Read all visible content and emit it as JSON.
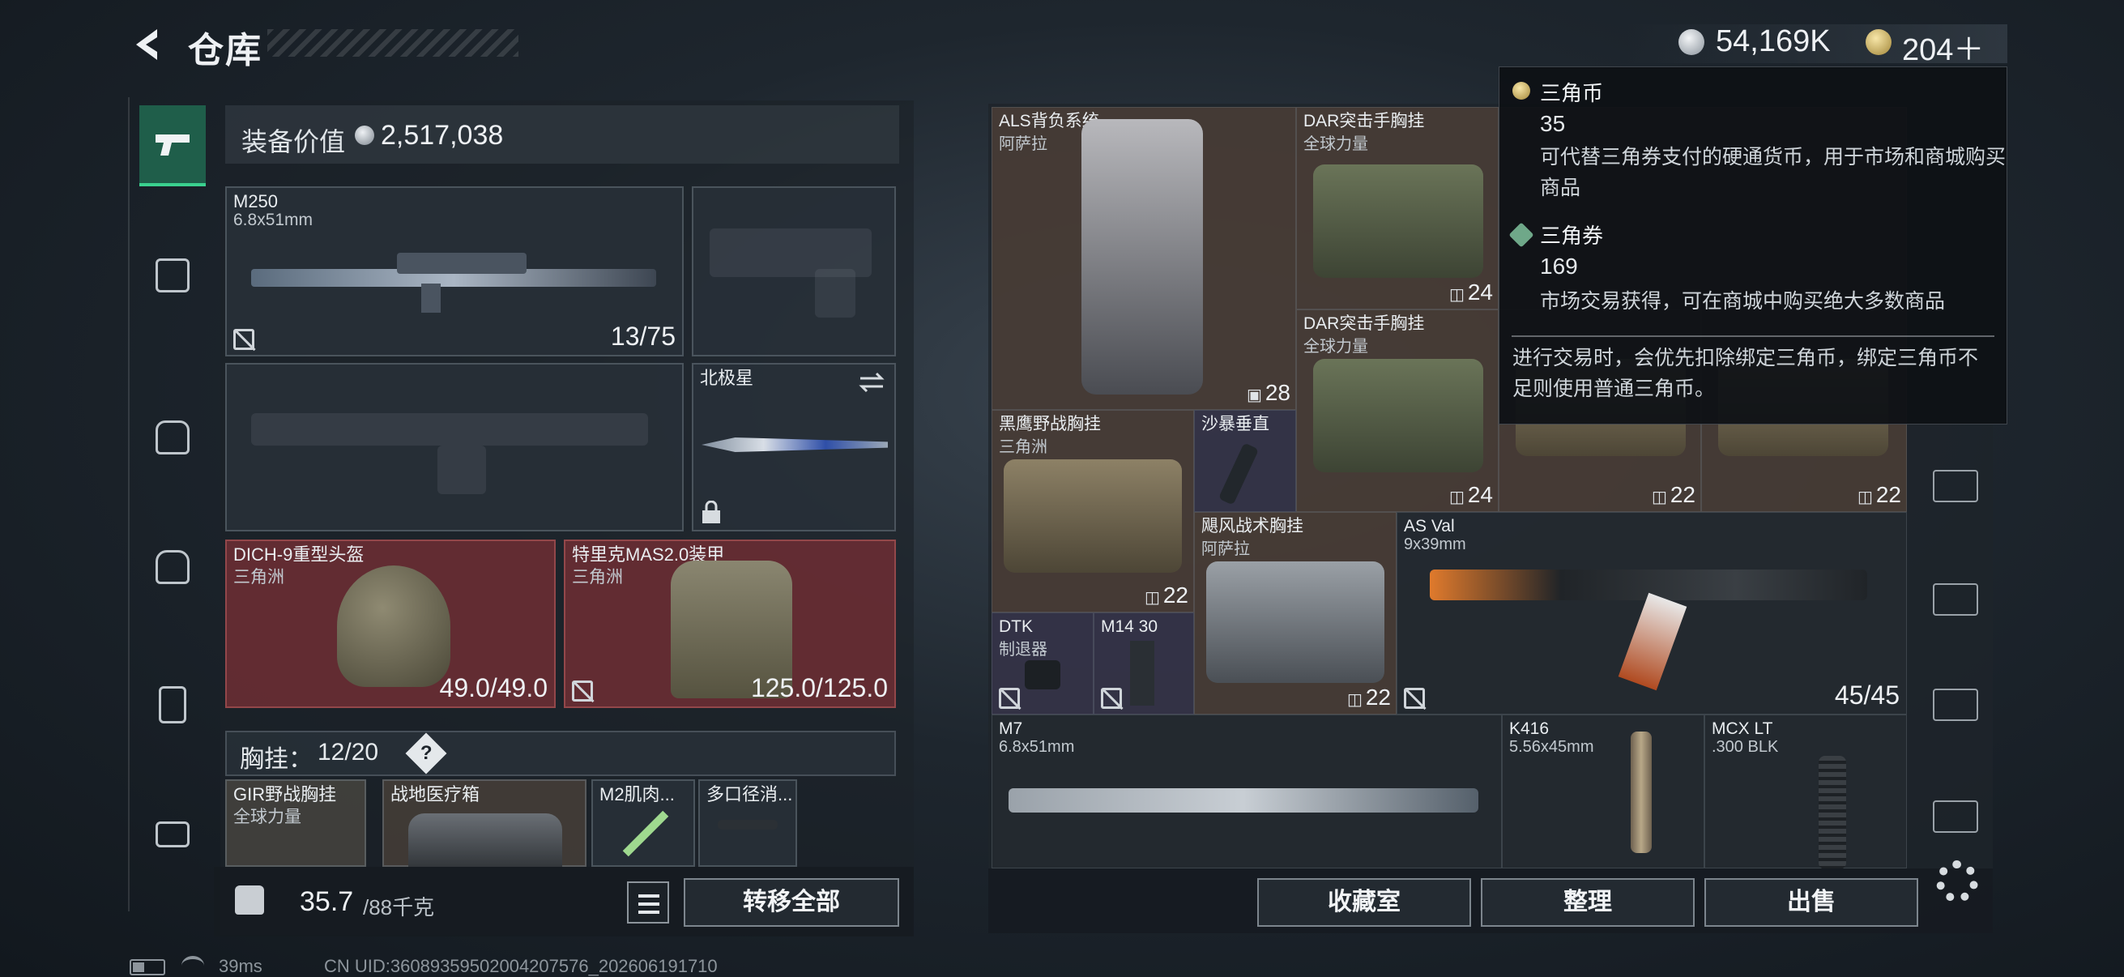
{
  "header": {
    "title": "仓库",
    "balance_main": "54,169K",
    "balance_tri": "204＋"
  },
  "equipment": {
    "label": "装备价值",
    "value": "2,517,038",
    "primary": {
      "name": "M250",
      "caliber": "6.8x51mm",
      "ammo": "13/75"
    },
    "melee": {
      "name": "北极星"
    },
    "helmet": {
      "name": "DICH-9重型头盔",
      "faction": "三角洲",
      "durability": "49.0/49.0"
    },
    "armor": {
      "name": "特里克MAS2.0装甲",
      "faction": "三角洲",
      "durability": "125.0/125.0"
    },
    "chest": {
      "label": "胸挂：",
      "count": "12/20",
      "help": "?"
    },
    "chest_items": [
      {
        "name": "GIR野战胸挂",
        "sub": "全球力量"
      },
      {
        "name": "战地医疗箱",
        "sub": ""
      },
      {
        "name": "M2肌肉...",
        "sub": ""
      },
      {
        "name": "多口径消...",
        "sub": ""
      }
    ]
  },
  "footer_left": {
    "weight": "35.7",
    "weight_cap": "/88千克",
    "transfer_all": "转移全部"
  },
  "stash": {
    "items": [
      {
        "name": "ALS背负系统",
        "sub": "阿萨拉",
        "badge": "28"
      },
      {
        "name": "DAR突击手胸挂",
        "sub": "全球力量",
        "badge": "24"
      },
      {
        "name": "DAR突击手胸挂",
        "sub": "全球力量",
        "badge": "24"
      },
      {
        "name": "黑鹰野战胸挂",
        "sub": "三角洲",
        "badge": "22"
      },
      {
        "name": "沙暴垂直",
        "sub": ""
      },
      {
        "name": "飓风战术胸挂",
        "sub": "阿萨拉",
        "badge": "22"
      },
      {
        "name": "AS Val",
        "sub": "9x39mm",
        "ammo": "45/45"
      },
      {
        "name": "DTK",
        "sub": "制退器"
      },
      {
        "name": "M14 30",
        "sub": ""
      },
      {
        "name": "M7",
        "sub": "6.8x51mm"
      },
      {
        "name": "K416",
        "sub": "5.56x45mm"
      },
      {
        "name": "MCX LT",
        "sub": ".300 BLK"
      }
    ],
    "hidden_badges": [
      "22",
      "22"
    ],
    "buttons": {
      "collection": "收藏室",
      "sort": "整理",
      "sell": "出售"
    }
  },
  "tooltip": {
    "coin_title": "三角币",
    "coin_amount": "35",
    "coin_desc": "可代替三角券支付的硬通货币，用于市场和商城购买商品",
    "ticket_title": "三角券",
    "ticket_amount": "169",
    "ticket_desc": "市场交易获得，可在商城中购买绝大多数商品",
    "note": "进行交易时，会优先扣除绑定三角币，绑定三角币不足则使用普通三角币。"
  },
  "status": {
    "ping": "39ms",
    "uid": "CN UID:3608935950200420757­6_202606191710"
  },
  "colors": {
    "accent": "#3ad18f",
    "red_slot": "#6e2e34",
    "panel": "#1c2228"
  }
}
